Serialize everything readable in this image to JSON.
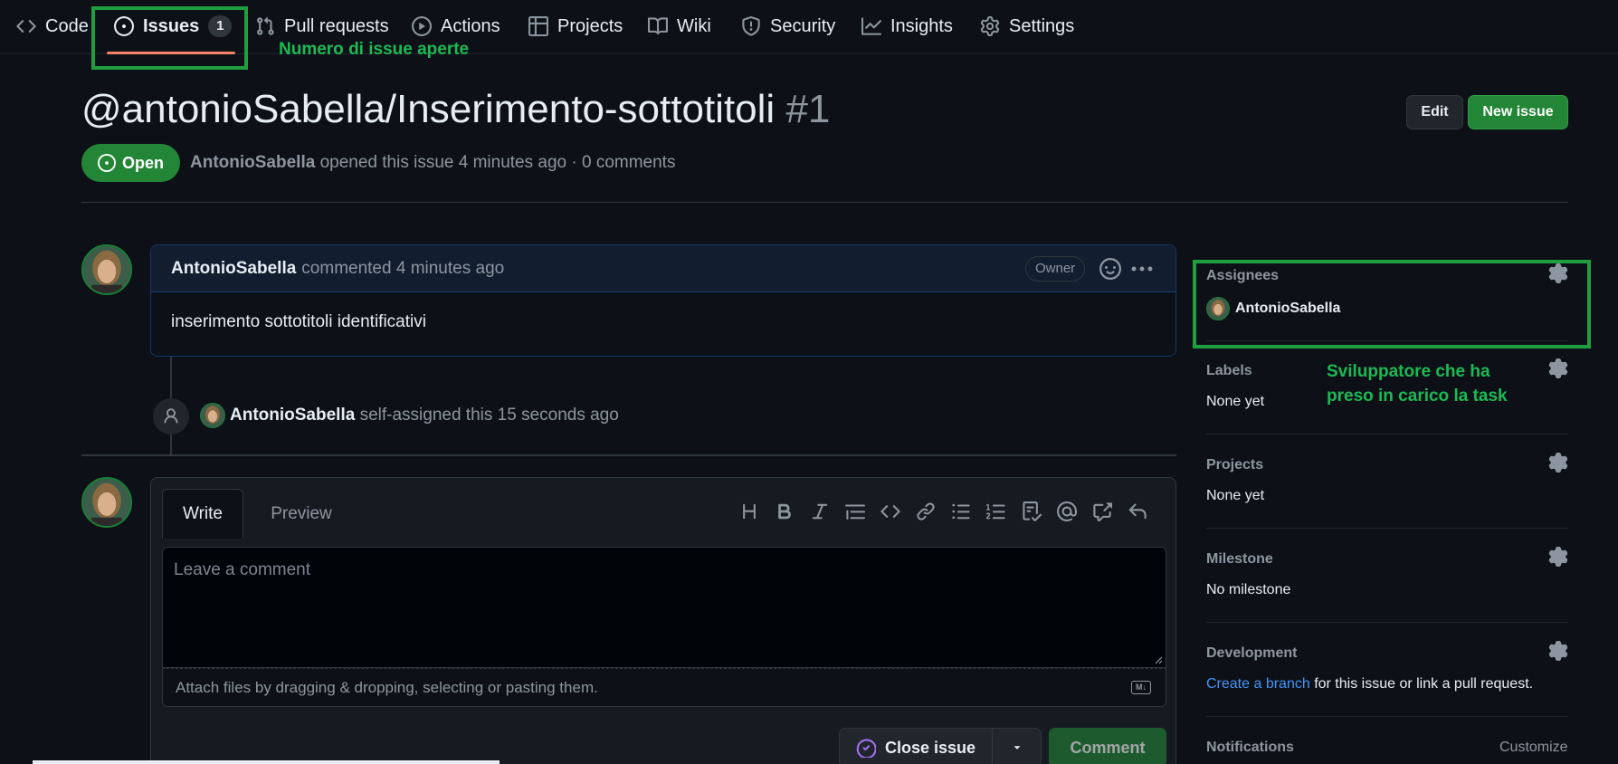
{
  "nav": {
    "items": [
      {
        "label": "Code",
        "icon": "code-icon"
      },
      {
        "label": "Issues",
        "icon": "issue-opened-icon",
        "count": "1"
      },
      {
        "label": "Pull requests",
        "icon": "git-pull-request-icon"
      },
      {
        "label": "Actions",
        "icon": "play-icon"
      },
      {
        "label": "Projects",
        "icon": "table-icon"
      },
      {
        "label": "Wiki",
        "icon": "book-icon"
      },
      {
        "label": "Security",
        "icon": "shield-icon"
      },
      {
        "label": "Insights",
        "icon": "graph-icon"
      },
      {
        "label": "Settings",
        "icon": "gear-icon"
      }
    ],
    "selected": "Issues"
  },
  "annotations": {
    "issues_note": "Numero di issue aperte",
    "assignee_note_line1": "Sviluppatore che ha",
    "assignee_note_line2": "preso in carico la task",
    "color": "#1f9e3f"
  },
  "issue": {
    "title": "@antonioSabella/Inserimento-sottotitoli",
    "number": "#1",
    "state": "Open",
    "author": "AntonioSabella",
    "meta_rest": "opened this issue 4 minutes ago · 0 comments",
    "edit_label": "Edit",
    "new_issue_label": "New issue"
  },
  "comment": {
    "author": "AntonioSabella",
    "time": "commented 4 minutes ago",
    "role": "Owner",
    "body": "inserimento sottotitoli identificativi"
  },
  "event": {
    "actor": "AntonioSabella",
    "text": "self-assigned this 15 seconds ago"
  },
  "editor": {
    "write_tab": "Write",
    "preview_tab": "Preview",
    "toolbar_icons": [
      "heading-icon",
      "bold-icon",
      "italic-icon",
      "quote-icon",
      "code-icon",
      "link-icon",
      "bulleted-list-icon",
      "numbered-list-icon",
      "task-list-icon",
      "mention-icon",
      "cross-reference-icon",
      "reply-icon"
    ],
    "placeholder": "Leave a comment",
    "attach_hint": "Attach files by dragging & dropping, selecting or pasting them.",
    "close_label": "Close issue",
    "comment_label": "Comment"
  },
  "sidebar": {
    "assignees": {
      "heading": "Assignees",
      "name": "AntonioSabella"
    },
    "labels": {
      "heading": "Labels",
      "value": "None yet"
    },
    "projects": {
      "heading": "Projects",
      "value": "None yet"
    },
    "milestone": {
      "heading": "Milestone",
      "value": "No milestone"
    },
    "development": {
      "heading": "Development",
      "link": "Create a branch",
      "rest": "for this issue or link a pull request."
    },
    "notifications": {
      "heading": "Notifications",
      "customize": "Customize"
    }
  },
  "colors": {
    "background": "#0d1117",
    "accent_green": "#238636",
    "tab_underline": "#f78166",
    "link": "#4493f8"
  }
}
